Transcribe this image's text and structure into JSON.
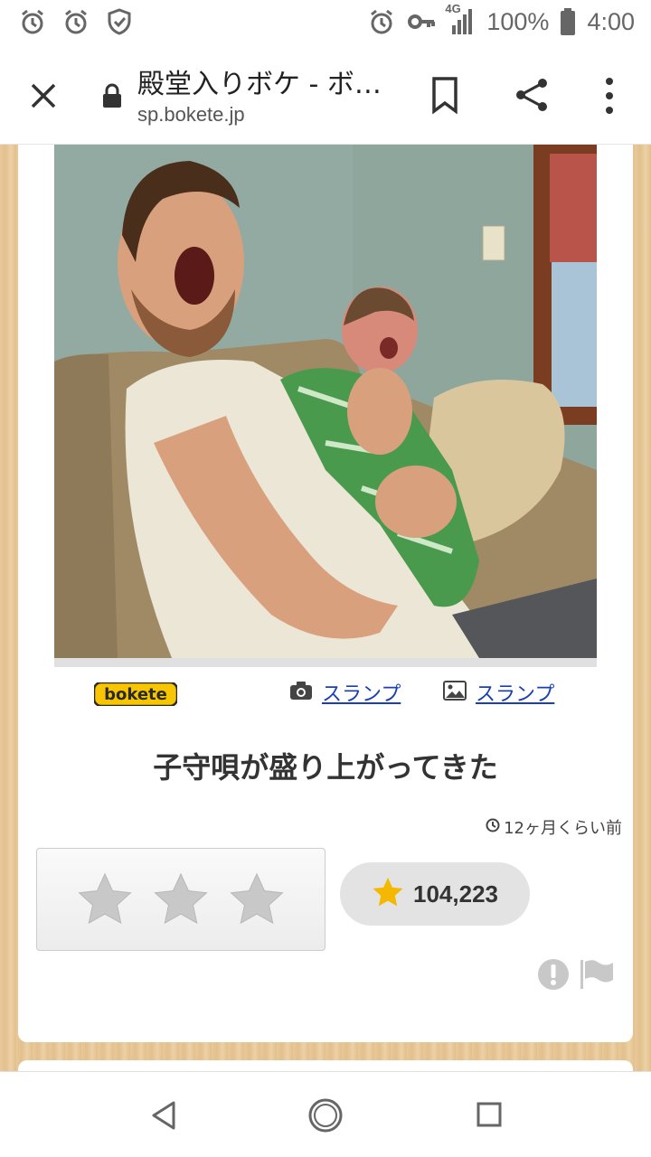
{
  "status_bar": {
    "left_icons": [
      "alarm-icon",
      "alarm-icon",
      "shield-check-icon"
    ],
    "right_icons": [
      "alarm-icon",
      "key-icon",
      "signal-4g-icon",
      "battery-icon"
    ],
    "network": "4G",
    "battery": "100%",
    "time": "4:00"
  },
  "browser": {
    "title": "殿堂入りボケ - ボ…",
    "url": "sp.bokete.jp"
  },
  "post": {
    "logo_text": "bokete",
    "photo_credit": "スランプ",
    "image_credit": "スランプ",
    "caption": "子守唄が盛り上がってきた",
    "timestamp": "12ヶ月くらい前",
    "star_count": "104,223"
  },
  "colors": {
    "link": "#1a3fb3",
    "star_gold": "#f5b800",
    "logo_yellow": "#f7c600"
  }
}
